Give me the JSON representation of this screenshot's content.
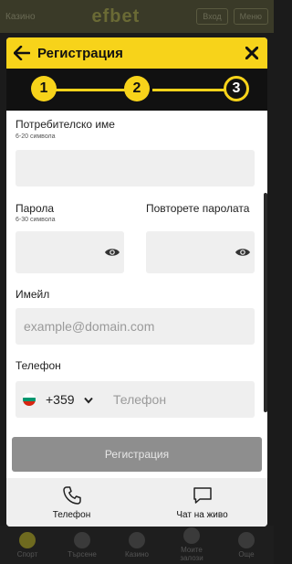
{
  "background": {
    "brand": "efbet",
    "left_label": "Казино",
    "login_label": "Вход",
    "menu_label": "Меню",
    "nav": [
      "Спорт",
      "Търсене",
      "Казино",
      "Моите залози",
      "Още"
    ]
  },
  "modal": {
    "title": "Регистрация",
    "steps": [
      "1",
      "2",
      "3"
    ],
    "current_step": 3
  },
  "form": {
    "username": {
      "label": "Потребителско име",
      "hint": "6-20 символа",
      "value": ""
    },
    "password": {
      "label": "Парола",
      "hint": "6-30 символа",
      "value": ""
    },
    "password_repeat": {
      "label": "Повторете паролата",
      "value": ""
    },
    "email": {
      "label": "Имейл",
      "placeholder": "example@domain.com"
    },
    "phone": {
      "label": "Телефон",
      "country_code": "+359",
      "placeholder": "Телефон"
    }
  },
  "submit_label": "Регистрация",
  "footer": {
    "phone_label": "Телефон",
    "chat_label": "Чат на живо"
  },
  "colors": {
    "accent": "#f7d31a",
    "dark": "#111111",
    "field_bg": "#efefef",
    "button_disabled": "#8e8e8e"
  }
}
